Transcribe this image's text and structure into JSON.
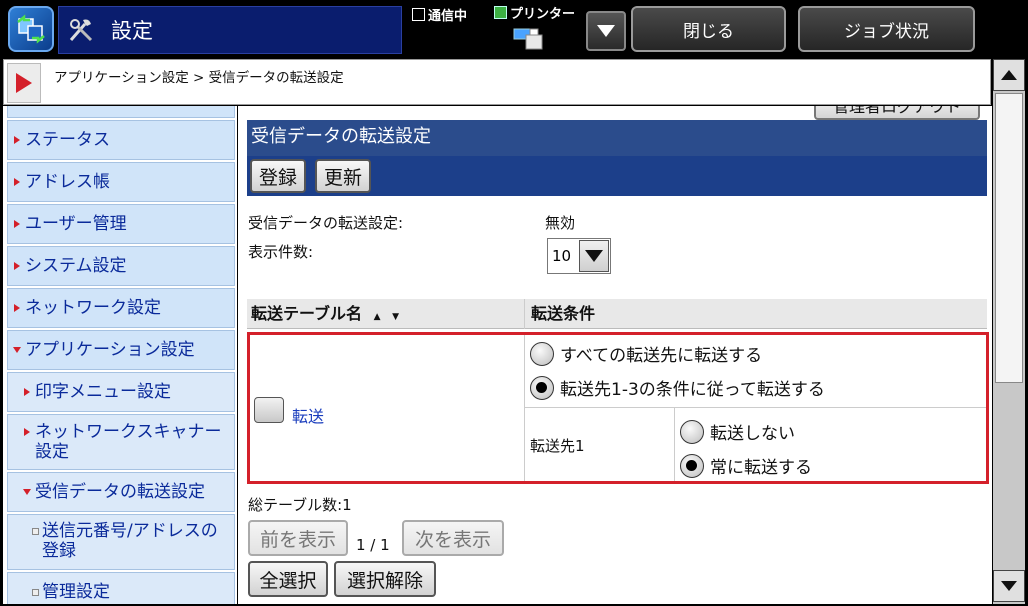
{
  "header": {
    "title": "設定",
    "status_comm": "通信中",
    "status_printer": "プリンター",
    "close_label": "閉じる",
    "job_status_label": "ジョブ状況"
  },
  "breadcrumb": "アプリケーション設定 > 受信データの転送設定",
  "sidebar": {
    "items": [
      {
        "label": "ステータス"
      },
      {
        "label": "アドレス帳"
      },
      {
        "label": "ユーザー管理"
      },
      {
        "label": "システム設定"
      },
      {
        "label": "ネットワーク設定"
      },
      {
        "label": "アプリケーション設定"
      },
      {
        "label": "印字メニュー設定"
      },
      {
        "label": "ネットワークスキャナー設定"
      },
      {
        "label": "受信データの転送設定"
      },
      {
        "label": "送信元番号/アドレスの登録"
      },
      {
        "label": "管理設定"
      }
    ]
  },
  "main": {
    "admin_tab": "管理者ログアウト",
    "heading": "受信データの転送設定",
    "register_label": "登録",
    "update_label": "更新",
    "setting_label": "受信データの転送設定:",
    "setting_value": "無効",
    "count_label": "表示件数:",
    "count_value": "10",
    "table": {
      "col_name": "転送テーブル名",
      "col_condition": "転送条件",
      "row": {
        "name": "転送",
        "option_all": "すべての転送先に転送する",
        "option_conditional": "転送先1-3の条件に従って転送する",
        "dest_label": "転送先1",
        "dest_option_none": "転送しない",
        "dest_option_always": "常に転送する"
      }
    },
    "total_tables": "総テーブル数:1",
    "prev_label": "前を表示",
    "page_info": "1 / 1",
    "next_label": "次を表示",
    "select_all_label": "全選択",
    "deselect_label": "選択解除"
  },
  "colors": {
    "accent_red": "#d4202a",
    "heading_blue": "#2b4c8c",
    "sidebar_blue": "#d0e4f9",
    "link_blue": "#1a3dbd"
  }
}
